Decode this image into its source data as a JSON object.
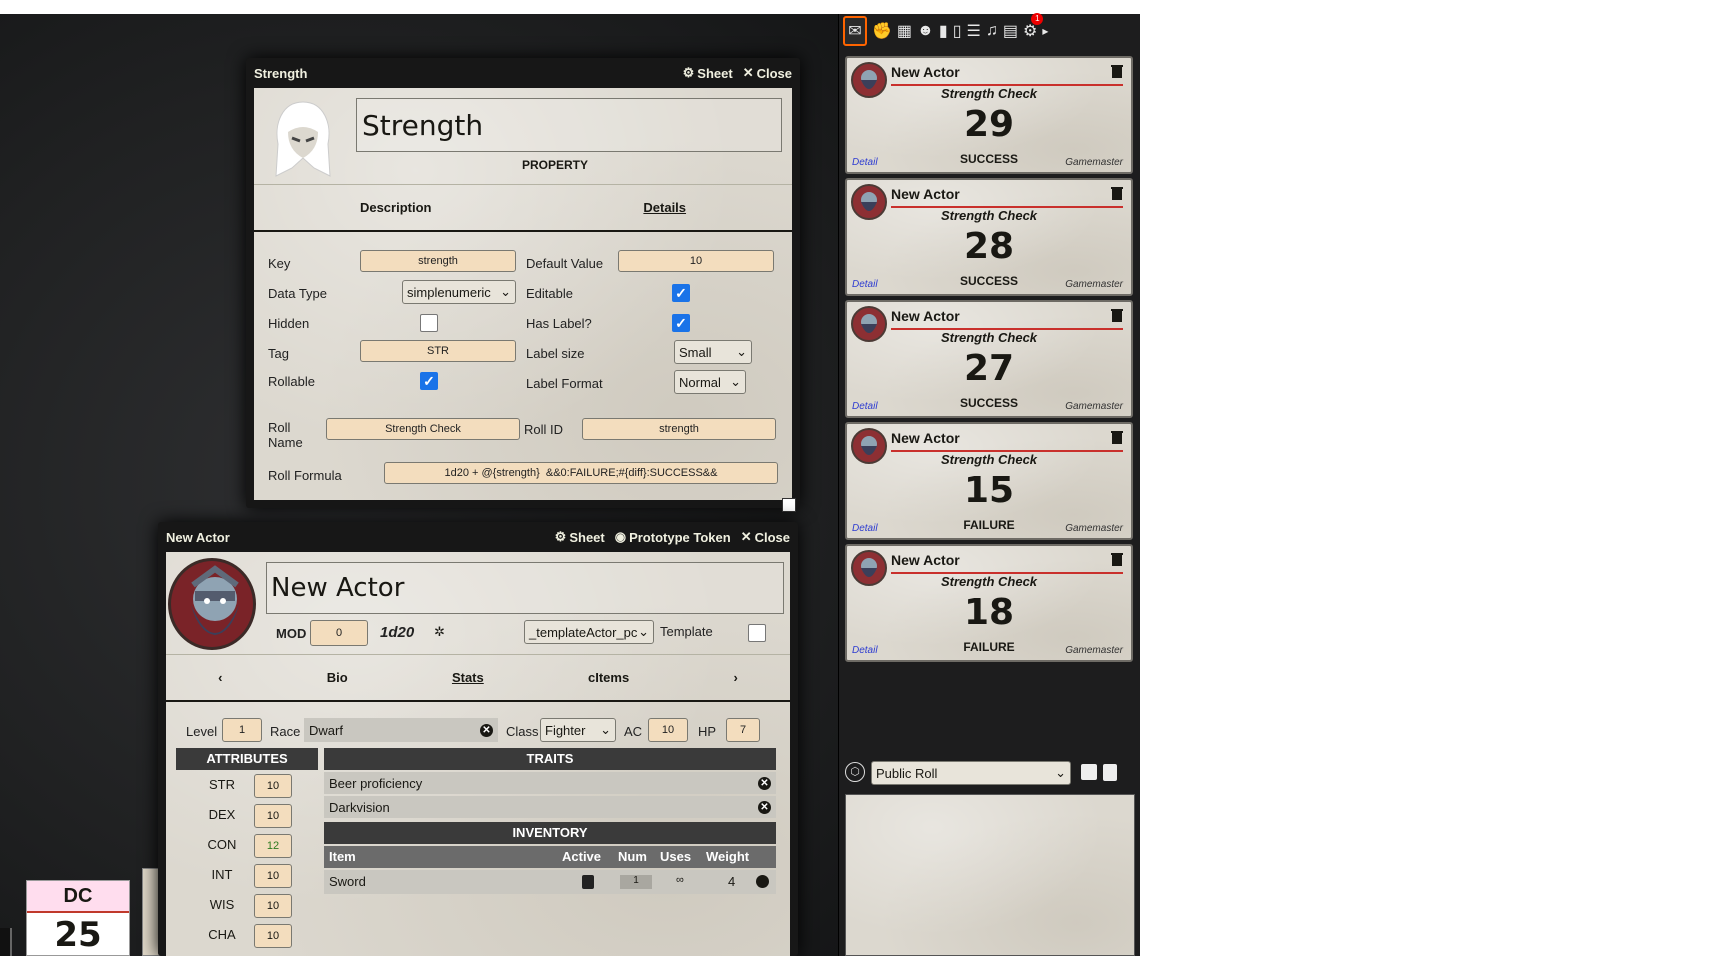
{
  "item_sheet": {
    "window_title": "Strength",
    "sheet_label": "Sheet",
    "close_label": "Close",
    "name": "Strength",
    "type_label": "PROPERTY",
    "tabs": [
      "Description",
      "Details"
    ],
    "key_label": "Key",
    "key_value": "strength",
    "default_label": "Default Value",
    "default_value": "10",
    "datatype_label": "Data Type",
    "datatype_value": "simplenumeric",
    "editable_label": "Editable",
    "hidden_label": "Hidden",
    "haslabel_label": "Has Label?",
    "tag_label": "Tag",
    "tag_value": "STR",
    "labelsize_label": "Label size",
    "labelsize_value": "Small",
    "rollable_label": "Rollable",
    "labelformat_label": "Label Format",
    "labelformat_value": "Normal",
    "rollname_label": "Roll\nName",
    "rollname_value": "Strength Check",
    "rollid_label": "Roll ID",
    "rollid_value": "strength",
    "formula_label": "Roll Formula",
    "formula_value": "1d20 + @{strength}  &&0:FAILURE;#{diff}:SUCCESS&&"
  },
  "actor_sheet": {
    "window_title": "New Actor",
    "sheet_label": "Sheet",
    "token_label": "Prototype Token",
    "close_label": "Close",
    "name": "New Actor",
    "mod_label": "MOD",
    "mod_value": "0",
    "dice": "1d20",
    "template_select": "_templateActor_pc",
    "template_label": "Template",
    "tabs": [
      "Bio",
      "Stats",
      "cItems"
    ],
    "level_label": "Level",
    "level_value": "1",
    "race_label": "Race",
    "race_value": "Dwarf",
    "class_label": "Class",
    "class_value": "Fighter",
    "ac_label": "AC",
    "ac_value": "10",
    "hp_label": "HP",
    "hp_value": "7",
    "attributes_title": "ATTRIBUTES",
    "attributes": [
      {
        "k": "STR",
        "v": "10"
      },
      {
        "k": "DEX",
        "v": "10"
      },
      {
        "k": "CON",
        "v": "12"
      },
      {
        "k": "INT",
        "v": "10"
      },
      {
        "k": "WIS",
        "v": "10"
      },
      {
        "k": "CHA",
        "v": "10"
      }
    ],
    "traits_title": "TRAITS",
    "traits": [
      "Beer proficiency",
      "Darkvision"
    ],
    "inventory_title": "INVENTORY",
    "inventory_headers": [
      "Item",
      "Active",
      "Num",
      "Uses",
      "Weight"
    ],
    "inventory": [
      {
        "item": "Sword",
        "num": "1",
        "uses": "∞",
        "weight": "4"
      }
    ]
  },
  "dc": {
    "label": "DC",
    "value": "25"
  },
  "chat": {
    "messages": [
      {
        "actor": "New Actor",
        "flavor": "Strength Check",
        "total": "29",
        "result": "SUCCESS",
        "detail": "Detail",
        "user": "Gamemaster"
      },
      {
        "actor": "New Actor",
        "flavor": "Strength Check",
        "total": "28",
        "result": "SUCCESS",
        "detail": "Detail",
        "user": "Gamemaster"
      },
      {
        "actor": "New Actor",
        "flavor": "Strength Check",
        "total": "27",
        "result": "SUCCESS",
        "detail": "Detail",
        "user": "Gamemaster"
      },
      {
        "actor": "New Actor",
        "flavor": "Strength Check",
        "total": "15",
        "result": "FAILURE",
        "detail": "Detail",
        "user": "Gamemaster"
      },
      {
        "actor": "New Actor",
        "flavor": "Strength Check",
        "total": "18",
        "result": "FAILURE",
        "detail": "Detail",
        "user": "Gamemaster"
      }
    ],
    "roll_mode": "Public Roll",
    "notification_count": "1"
  },
  "colors": {
    "accent": "#ff6400",
    "success_line": "#c9302c",
    "check": "#1a73e8"
  }
}
